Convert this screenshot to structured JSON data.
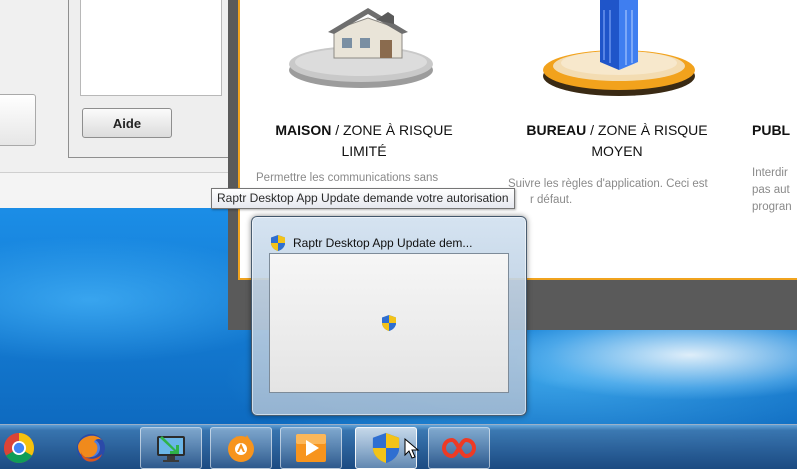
{
  "left_window": {
    "help_button_label": "Aide"
  },
  "right_window": {
    "cards": [
      {
        "title_bold": "MAISON",
        "title_rest": " / ZONE À RISQUE",
        "title_line2": "LIMITÉ",
        "description_line1": "Permettre les communications sans",
        "icon": "house-on-disc-icon"
      },
      {
        "title_bold": "BUREAU",
        "title_rest": " / ZONE À RISQUE",
        "title_line2": "MOYEN",
        "description_line1": "Suivre les règles d'application. Ceci est",
        "description_line2": "r défaut.",
        "icon": "office-building-on-disc-icon"
      },
      {
        "title_bold": "PUBL",
        "description_line1": "Interdir",
        "description_line2": "pas aut",
        "description_line3": "progran"
      }
    ],
    "accent_color": "#f0a31f"
  },
  "tooltip": {
    "text": "Raptr Desktop App Update demande votre autorisation"
  },
  "thumbnail": {
    "title": "Raptr Desktop App Update dem...",
    "icon": "uac-shield-icon"
  },
  "taskbar": {
    "items": [
      {
        "name": "chrome-icon"
      },
      {
        "name": "firefox-icon"
      },
      {
        "name": "monitor-download-icon"
      },
      {
        "name": "avast-icon"
      },
      {
        "name": "media-player-icon"
      },
      {
        "name": "uac-shield-icon",
        "active": true
      },
      {
        "name": "raptr-icon"
      }
    ]
  }
}
